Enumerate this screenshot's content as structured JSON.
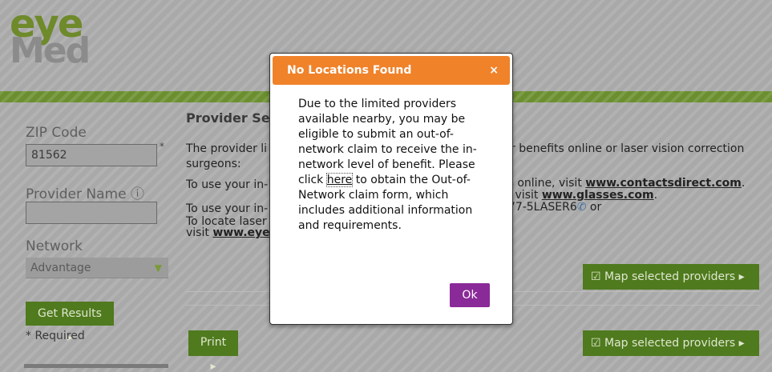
{
  "header": {
    "logo_top": "eye",
    "logo_bottom": "Med"
  },
  "form": {
    "zip_label": "ZIP Code",
    "zip_value": "81562",
    "required_star": "*",
    "provider_label": "Provider Name ⓘ",
    "provider_value": "",
    "network_label": "Network",
    "network_value": "Advantage",
    "get_results_label": "Get Results ▸",
    "required_note": "* Required"
  },
  "content": {
    "heading": "Provider Sea",
    "p1a": "The provider li",
    "p1b": "r benefits online or laser vision correction",
    "p1c": "surgeons:",
    "p2a": "To use your in-",
    "p2b_pre": "es online, visit ",
    "p2b_link": "www.contactsdirect.com",
    "p2b_post": ".",
    "p2c_pre": "e, visit ",
    "p2c_link": "www.glasses.com",
    "p2c_post": ".",
    "p2d": "To use your in-",
    "p2e": "877-5LASER6",
    "p2e_post": " or",
    "p2f": "To locate laser",
    "p2g_pre": "visit ",
    "p2g_link": "www.eye",
    "map_selected_label": "☑ Map selected providers ▸",
    "print_label": "Print ▸"
  },
  "modal": {
    "title": "No Locations Found",
    "close": "×",
    "body_pre": "Due to the limited providers available nearby, you may be eligible to submit an out-of-network claim to receive the in-network level of benefit. Please click ",
    "body_link": "here",
    "body_post": " to obtain the Out-of-Network claim form, which includes additional information and requirements.",
    "ok_label": "Ok"
  },
  "colors": {
    "header_green": "#6b8f2f",
    "modal_orange": "#f0822a",
    "ok_purple": "#8a2a98",
    "button_green": "#4f7a1e"
  }
}
